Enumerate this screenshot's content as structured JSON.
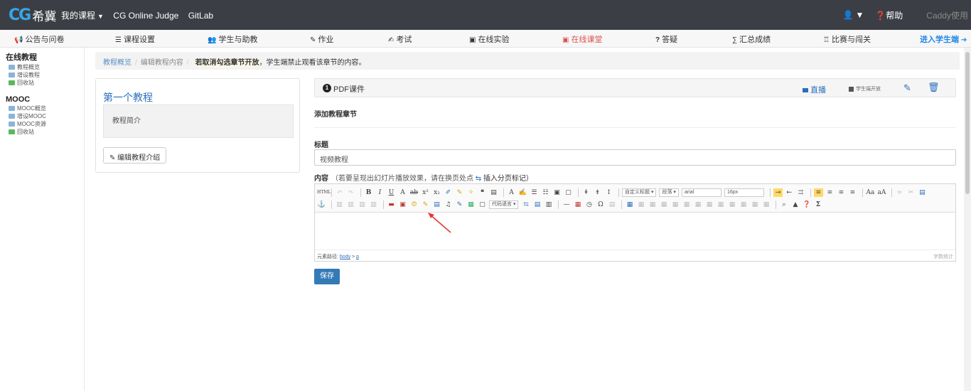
{
  "navbar": {
    "logo_cg": "CG",
    "logo_text": "希冀",
    "links": [
      "我的课程",
      "CG Online Judge",
      "GitLab"
    ],
    "help": "帮助",
    "username": "Caddy使用"
  },
  "menu": {
    "announcements": "公告与问卷",
    "course_settings": "课程设置",
    "students": "学生与助教",
    "homework": "作业",
    "exams": "考试",
    "online_lab": "在线实验",
    "online_class": "在线课堂",
    "qa": "答疑",
    "grades": "汇总成绩",
    "contests": "比赛与闯关",
    "student_view": "进入学生端"
  },
  "sidebar": {
    "group1": "在线教程",
    "group1_items": [
      "教程概览",
      "增设教程",
      "回收站"
    ],
    "group2": "MOOC",
    "group2_items": [
      "MOOC概览",
      "增设MOOC",
      "MOOC资源",
      "回收站"
    ]
  },
  "breadcrumb": {
    "overview": "教程概览",
    "current": "编辑教程内容",
    "note_bold": "若取消勾选章节开放",
    "note_rest": "，学生端禁止观看该章节的内容。"
  },
  "course_card": {
    "title": "第一个教程",
    "intro": "教程简介",
    "edit_button": "编辑教程介绍"
  },
  "section": {
    "number": "1",
    "title": "PDF课件",
    "live": "直播",
    "student_open": "学生端开放"
  },
  "form": {
    "add_chapter": "添加教程章节",
    "title_label": "标题",
    "title_value": "视频教程",
    "content_label": "内容",
    "content_hint": "（若要呈现出幻灯片播放效果，请在换页处点",
    "content_hint_insert": "插入分页标记）",
    "save_button": "保存"
  },
  "editor": {
    "select_heading": "自定义标题",
    "select_paragraph": "段落",
    "select_font": "arial",
    "select_size": "16px",
    "code_lang": "代码语言",
    "status_prefix": "元素路径:",
    "path_body": "body",
    "path_p": "p",
    "path_sep": ">",
    "word_count": "字数统计"
  },
  "colors": {
    "navbar_bg": "#3b3f45",
    "accent_blue": "#337ab7",
    "active_red": "#d9534f"
  }
}
